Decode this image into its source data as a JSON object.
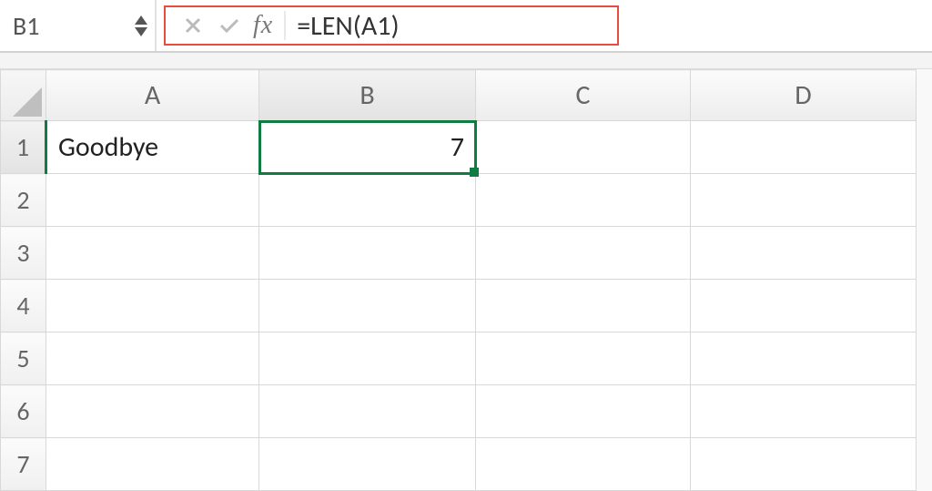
{
  "formula_bar": {
    "name_box_value": "B1",
    "fx_label": "fx",
    "formula_value": "=LEN(A1)"
  },
  "columns": [
    "A",
    "B",
    "C",
    "D"
  ],
  "rows": [
    "1",
    "2",
    "3",
    "4",
    "5",
    "6",
    "7"
  ],
  "active_column_index": 1,
  "active_row_index": 0,
  "cells": {
    "A1": "Goodbye",
    "B1": "7"
  },
  "selection": {
    "active_cell": "B1"
  },
  "highlight": {
    "formula_bar_outline": "#e74c3c",
    "selection_color": "#107c41"
  }
}
